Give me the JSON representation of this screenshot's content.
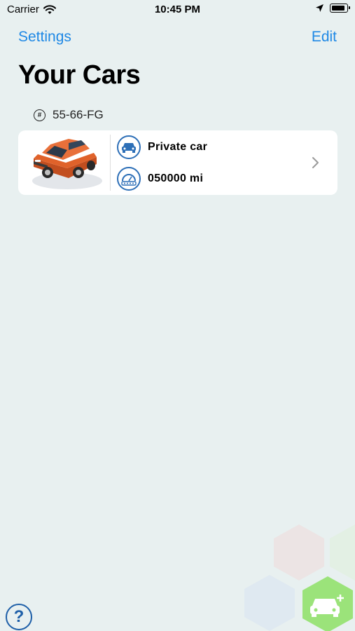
{
  "status_bar": {
    "carrier": "Carrier",
    "time": "10:45 PM"
  },
  "nav": {
    "left_label": "Settings",
    "right_label": "Edit"
  },
  "page": {
    "title": "Your Cars"
  },
  "cars": [
    {
      "plate": "55-66-FG",
      "type": "Private car",
      "mileage": "050000 mi",
      "color": "#E0622A"
    }
  ],
  "colors": {
    "accent": "#1E88E5",
    "icon_blue": "#2D6FB7",
    "background": "#E8F0F0",
    "add_button": "#9BE37A"
  },
  "icons": {
    "wifi": "wifi-icon",
    "location": "location-arrow-icon",
    "battery": "battery-icon",
    "hash": "hash-icon",
    "car_type": "car-front-icon",
    "mileage": "odometer-icon",
    "chevron": "chevron-right-icon",
    "help": "question-icon",
    "add_car": "add-car-icon"
  },
  "help_symbol": "?"
}
